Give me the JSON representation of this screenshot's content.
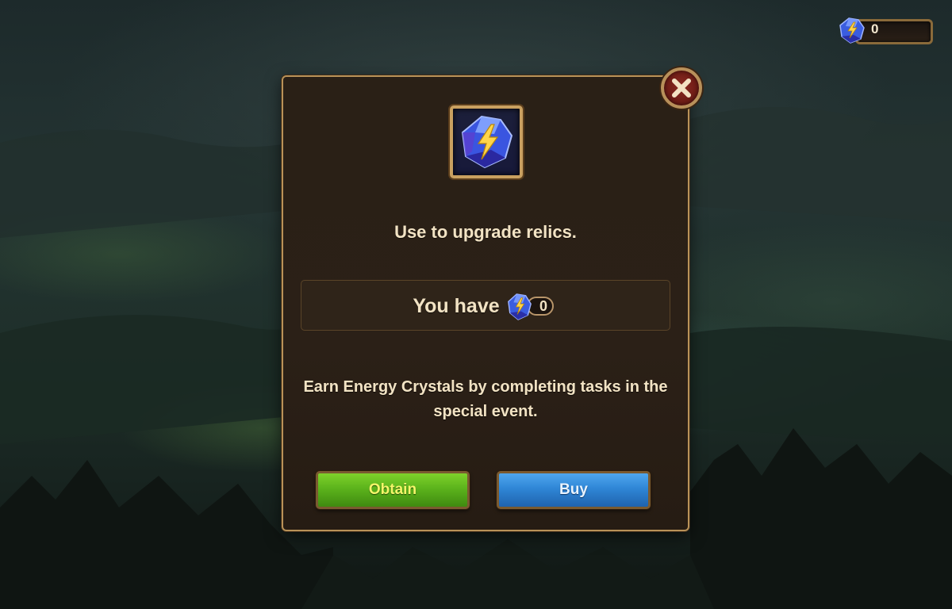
{
  "currency": {
    "value": "0",
    "icon": "energy-crystal-icon"
  },
  "item": {
    "icon": "energy-crystal-icon"
  },
  "dialog": {
    "description": "Use to upgrade relics.",
    "have_label": "You have",
    "have_value": "0",
    "info": "Earn Energy Crystals by completing tasks in the special event.",
    "obtain_label": "Obtain",
    "buy_label": "Buy",
    "close_icon": "close-icon"
  },
  "colors": {
    "panel": "#2a2016",
    "frame_gold": "#c9a060",
    "obtain_green": "#5cb31c",
    "buy_blue": "#2f86d6",
    "close_red": "#6a1a14",
    "text_cream": "#f2e3c4"
  }
}
